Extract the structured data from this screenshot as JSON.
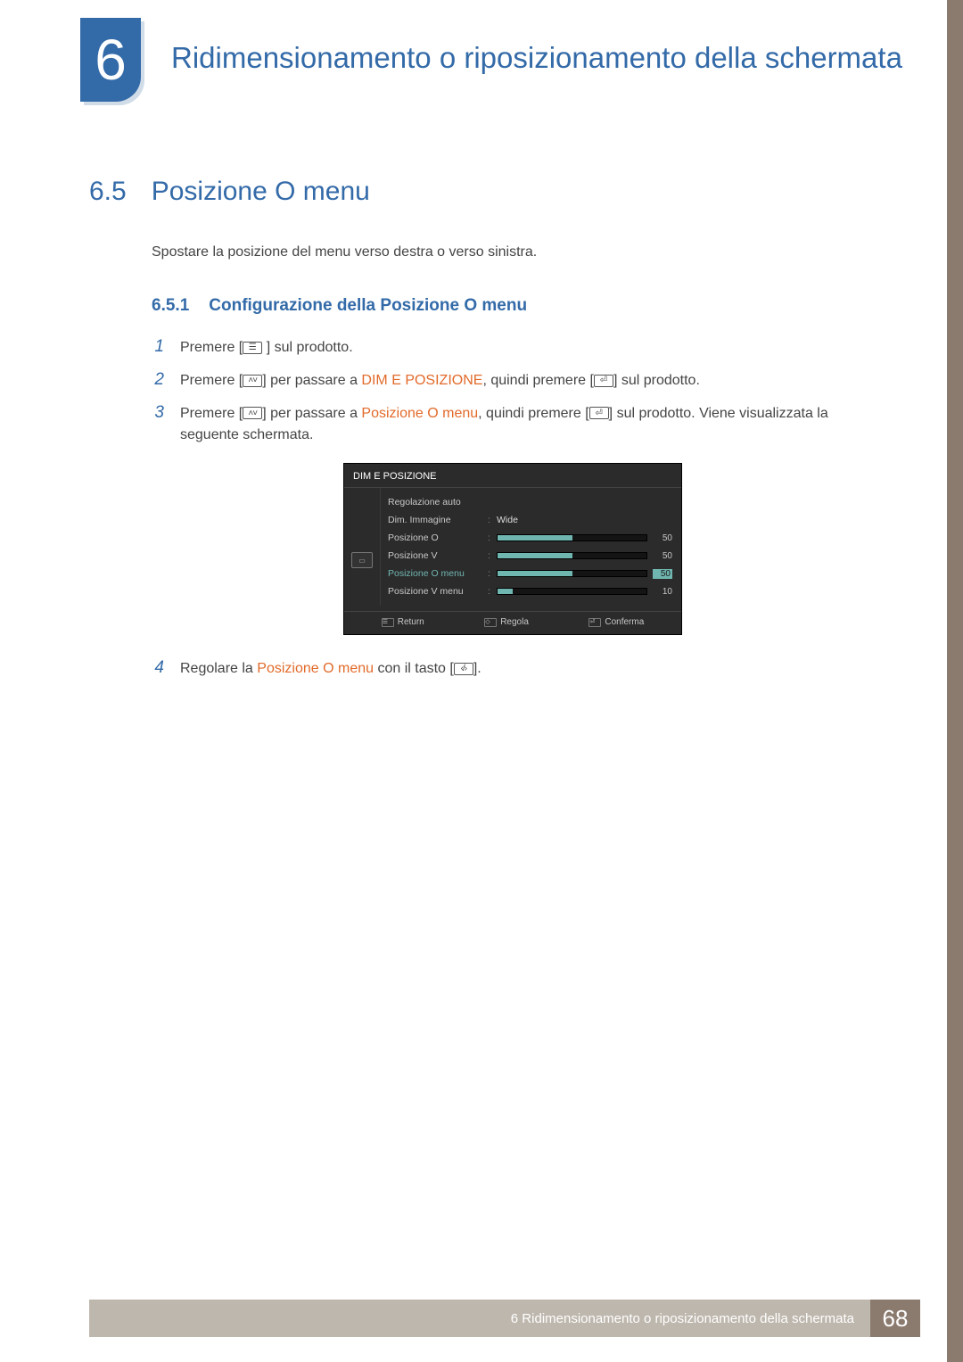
{
  "chapter": {
    "number": "6",
    "title": "Ridimensionamento o riposizionamento della schermata"
  },
  "section": {
    "number": "6.5",
    "title": "Posizione O menu",
    "intro": "Spostare la posizione del menu verso destra o verso sinistra."
  },
  "subsection": {
    "number": "6.5.1",
    "title": "Configurazione della Posizione O menu"
  },
  "steps": {
    "s1": {
      "num": "1",
      "pre": "Premere [",
      "post": " ] sul prodotto."
    },
    "s2": {
      "num": "2",
      "a": "Premere [",
      "b": "] per passare a ",
      "hl": "DIM E POSIZIONE",
      "c": ", quindi premere [",
      "d": "] sul prodotto."
    },
    "s3": {
      "num": "3",
      "a": "Premere [",
      "b": "] per passare a ",
      "hl": "Posizione O menu",
      "c": ", quindi premere [",
      "d": "] sul prodotto. Viene visualizzata la seguente schermata."
    },
    "s4": {
      "num": "4",
      "a": "Regolare la ",
      "hl": "Posizione O menu",
      "b": " con il tasto [",
      "c": "]."
    }
  },
  "osd": {
    "title": "DIM E POSIZIONE",
    "rows": [
      {
        "label": "Regolazione auto",
        "type": "none"
      },
      {
        "label": "Dim. Immagine",
        "type": "text",
        "value": "Wide"
      },
      {
        "label": "Posizione O",
        "type": "bar",
        "value": 50,
        "fill": 50
      },
      {
        "label": "Posizione V",
        "type": "bar",
        "value": 50,
        "fill": 50
      },
      {
        "label": "Posizione O menu",
        "type": "bar",
        "value": 50,
        "fill": 50,
        "active": true
      },
      {
        "label": "Posizione V menu",
        "type": "bar",
        "value": 10,
        "fill": 10
      }
    ],
    "footer": {
      "return": "Return",
      "regola": "Regola",
      "conferma": "Conferma"
    }
  },
  "footer": {
    "text": "6 Ridimensionamento o riposizionamento della schermata",
    "page": "68"
  }
}
